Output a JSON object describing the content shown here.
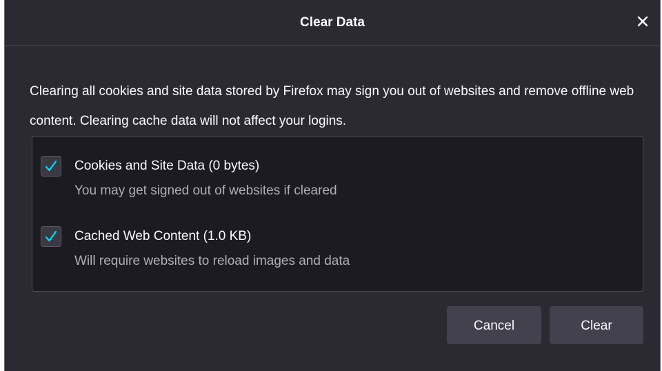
{
  "dialog": {
    "title": "Clear Data",
    "description": "Clearing all cookies and site data stored by Firefox may sign you out of websites and remove offline web content. Clearing cache data will not affect your logins.",
    "close_icon": "close-icon",
    "options": [
      {
        "label": "Cookies and Site Data (0 bytes)",
        "description": "You may get signed out of websites if cleared",
        "checked": true
      },
      {
        "label": "Cached Web Content (1.0 KB)",
        "description": "Will require websites to reload images and data",
        "checked": true
      }
    ],
    "buttons": {
      "cancel": "Cancel",
      "clear": "Clear"
    }
  },
  "colors": {
    "background": "#2b2a33",
    "box_background": "#1c1b22",
    "check_accent": "#00ddff",
    "button_background": "#42414d",
    "text": "#fbfbfe",
    "secondary_text": "#afafb5"
  }
}
